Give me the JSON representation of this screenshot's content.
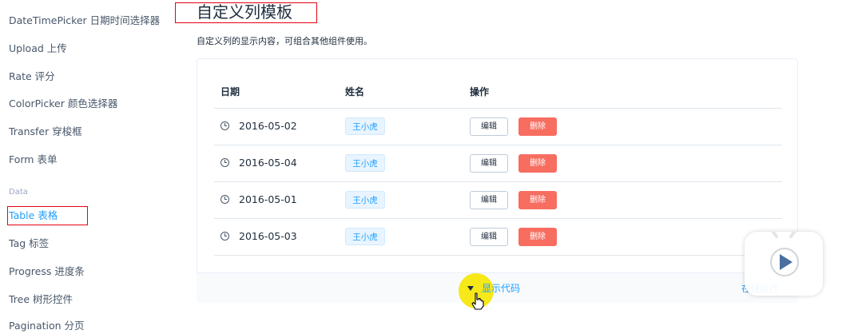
{
  "sidebar": {
    "items": [
      {
        "label": "DateTimePicker 日期时间选择器"
      },
      {
        "label": "Upload 上传"
      },
      {
        "label": "Rate 评分"
      },
      {
        "label": "ColorPicker 颜色选择器"
      },
      {
        "label": "Transfer 穿梭框"
      },
      {
        "label": "Form 表单"
      },
      {
        "label": "Table 表格"
      },
      {
        "label": "Tag 标签"
      },
      {
        "label": "Progress 进度条"
      },
      {
        "label": "Tree 树形控件"
      },
      {
        "label": "Pagination 分页"
      }
    ],
    "group_label": "Data",
    "active_item": "Table 表格"
  },
  "main": {
    "title": "自定义列模板",
    "description": "自定义列的显示内容，可组合其他组件使用。",
    "table": {
      "headers": [
        "日期",
        "姓名",
        "操作"
      ],
      "rows": [
        {
          "date": "2016-05-02",
          "name": "王小虎",
          "edit": "编辑",
          "delete": "删除"
        },
        {
          "date": "2016-05-04",
          "name": "王小虎",
          "edit": "编辑",
          "delete": "删除"
        },
        {
          "date": "2016-05-01",
          "name": "王小虎",
          "edit": "编辑",
          "delete": "删除"
        },
        {
          "date": "2016-05-03",
          "name": "王小虎",
          "edit": "编辑",
          "delete": "删除"
        }
      ]
    },
    "code_bar": {
      "toggle_label": "显示代码",
      "run_label": "在线运行"
    }
  },
  "icons": {
    "date": "clock-icon",
    "toggle": "caret-down-icon",
    "cursor": "hand-pointer-icon",
    "overlay": "video-play-icon"
  },
  "colors": {
    "accent": "#20a0ff",
    "danger": "#f76d60",
    "annotation_box": "#e60012",
    "cursor_highlight": "#f5e600"
  }
}
